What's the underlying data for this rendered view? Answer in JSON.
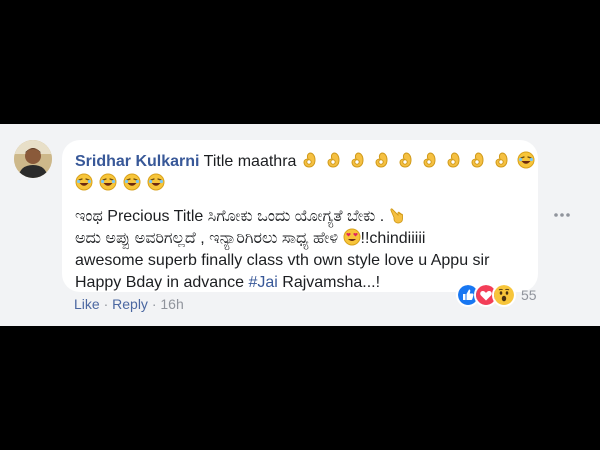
{
  "comment": {
    "author": "Sridhar Kulkarni",
    "line1_text": "Title maathra",
    "line3_text": "ಇಂಥ Precious Title ಸಿಗೋಕು ಒಂದು ಯೋಗ್ಯತೆ ಬೇಕು .",
    "line4_text": "ಅದು ಅಪ್ಪು ಅವರಿಗಲ್ಲದೆ , ಇನ್ಯಾರಿಗಿರಲು ಸಾಧ್ಯ ಹೇಳಿ",
    "line4_after": "!!chindiiiii",
    "line5_text": "awesome superb finally class vth own style love u Appu sir",
    "line6_before": "Happy Bday in advance ",
    "hashtag": "#Jai",
    "line6_after": " Rajvamsha...!",
    "emojis": {
      "line1": [
        "ok-hand",
        "ok-hand",
        "ok-hand",
        "ok-hand",
        "ok-hand",
        "ok-hand",
        "ok-hand",
        "ok-hand",
        "ok-hand",
        "laughing"
      ],
      "line2": [
        "laughing",
        "laughing",
        "laughing",
        "laughing"
      ],
      "line3": [
        "pointing-up-left"
      ],
      "line4": [
        "heart-eyes"
      ]
    }
  },
  "actions": {
    "like": "Like",
    "separator1": " · ",
    "reply": "Reply",
    "separator2": " · ",
    "time": "16h"
  },
  "reactions": {
    "types": [
      "like",
      "love",
      "wow"
    ],
    "count": "55"
  },
  "colors": {
    "link": "#385898",
    "panel": "#f2f3f5",
    "bubble": "#ffffff",
    "meta": "#90949c"
  }
}
